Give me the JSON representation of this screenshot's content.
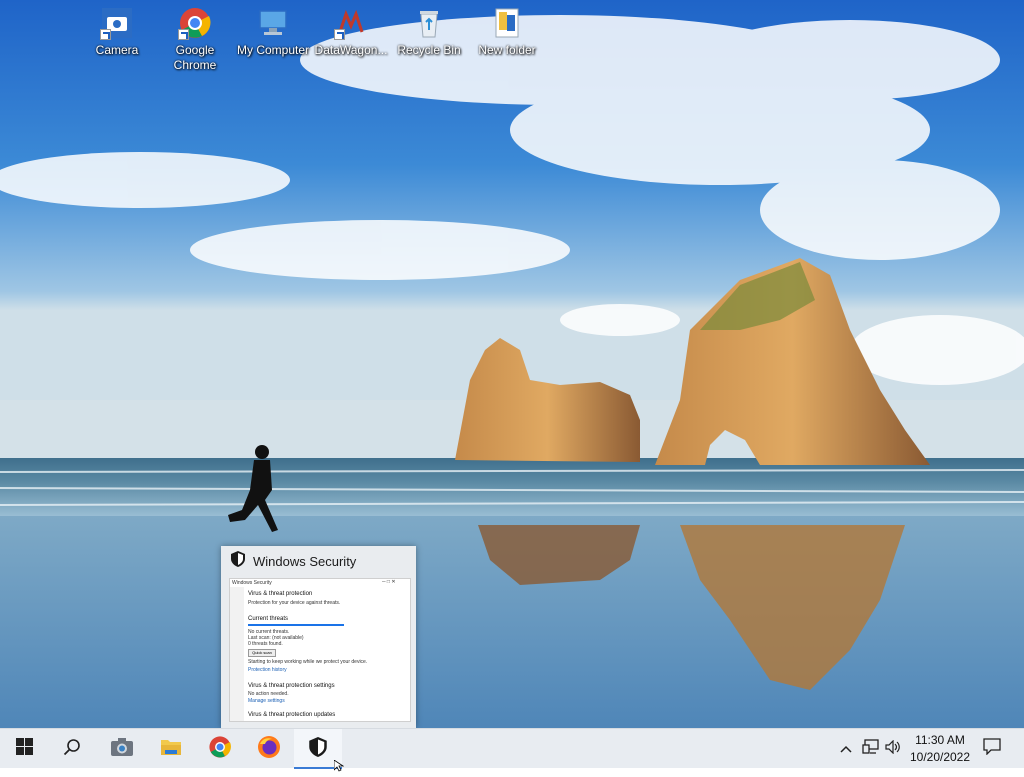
{
  "desktop": {
    "icons": [
      {
        "label": "Camera",
        "icon": "camera-icon"
      },
      {
        "label": "Google\nChrome",
        "icon": "chrome-icon"
      },
      {
        "label": "My Computer",
        "icon": "computer-icon"
      },
      {
        "label": "DataWagon...",
        "icon": "datawagon-icon"
      },
      {
        "label": "Recycle Bin",
        "icon": "recycle-bin-icon"
      },
      {
        "label": "New folder",
        "icon": "folder-icon"
      }
    ]
  },
  "preview": {
    "title": "Windows Security",
    "content": {
      "window_label": "Windows Security",
      "heading": "Virus & threat protection",
      "subheading": "Protection for your device against threats.",
      "section_current": "Current threats",
      "line1": "No current threats.",
      "line2": "Last scan: (not available)",
      "line3": "0 threats found.",
      "scan_button": "Quick scan",
      "line4": "Starting to keep working while we protect your device.",
      "link1": "Protection history",
      "section_settings": "Virus & threat protection settings",
      "line5": "No action needed.",
      "link2": "Manage settings",
      "section_updates": "Virus & threat protection updates"
    }
  },
  "taskbar": {
    "apps": [
      {
        "name": "start",
        "icon": "windows-logo-icon"
      },
      {
        "name": "search",
        "icon": "search-icon"
      },
      {
        "name": "camera",
        "icon": "camera-icon"
      },
      {
        "name": "file-explorer",
        "icon": "folder-icon"
      },
      {
        "name": "chrome",
        "icon": "chrome-icon"
      },
      {
        "name": "firefox",
        "icon": "firefox-icon"
      },
      {
        "name": "windows-security",
        "icon": "shield-icon",
        "active": true
      }
    ],
    "tray": {
      "time": "11:30 AM",
      "date": "10/20/2022"
    }
  },
  "colors": {
    "accent": "#3a7bd5",
    "taskbar_bg": "#e8ecf1"
  }
}
